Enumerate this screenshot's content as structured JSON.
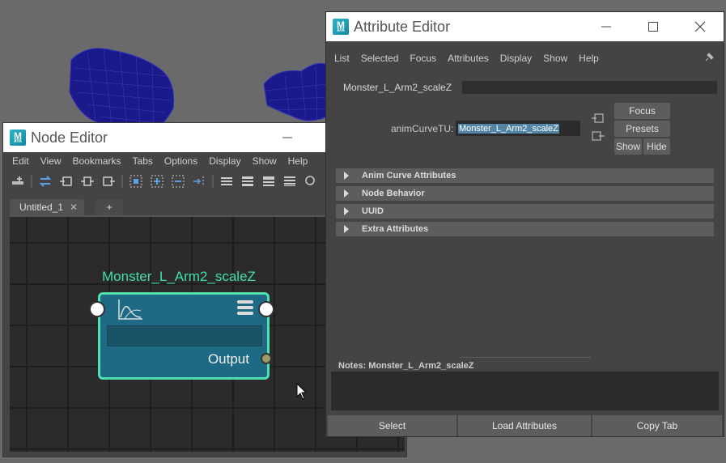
{
  "node_editor": {
    "title": "Node Editor",
    "menu": [
      "Edit",
      "View",
      "Bookmarks",
      "Tabs",
      "Options",
      "Display",
      "Show",
      "Help"
    ],
    "tabs": [
      {
        "label": "Untitled_1",
        "close": "✕"
      }
    ],
    "add_tab_label": "+",
    "node": {
      "name": "Monster_L_Arm2_scaleZ",
      "output_label": "Output",
      "icon": "anim-curve-icon"
    },
    "toolbar_icons": [
      "graph-add-icon",
      "swap-icon",
      "input-icon",
      "input-output-icon",
      "output-icon",
      "frame-selection-icon",
      "add-selected-icon",
      "remove-selected-icon",
      "relayout-icon",
      "simple-mode-icon",
      "connected-mode-icon",
      "all-mode-icon",
      "custom-mode-icon",
      "search-icon"
    ]
  },
  "attribute_editor": {
    "title": "Attribute Editor",
    "menu": [
      "List",
      "Selected",
      "Focus",
      "Attributes",
      "Display",
      "Show",
      "Help"
    ],
    "tab": "Monster_L_Arm2_scaleZ",
    "field_label": "animCurveTU:",
    "field_value": "Monster_L_Arm2_scaleZ",
    "buttons": {
      "focus": "Focus",
      "presets": "Presets",
      "show": "Show",
      "hide": "Hide"
    },
    "sections": [
      "Anim Curve Attributes",
      "Node Behavior",
      "UUID",
      "Extra Attributes"
    ],
    "notes_label": "Notes:  Monster_L_Arm2_scaleZ",
    "bottom_buttons": [
      "Select",
      "Load Attributes",
      "Copy Tab"
    ]
  },
  "window_controls": {
    "minimize": "minimize-icon",
    "maximize": "maximize-icon",
    "close": "close-icon"
  },
  "colors": {
    "accent_node": "#4fe0b0",
    "node_fill": "#1e6a84",
    "panel_bg": "#444444",
    "selection": "#5285a6"
  }
}
